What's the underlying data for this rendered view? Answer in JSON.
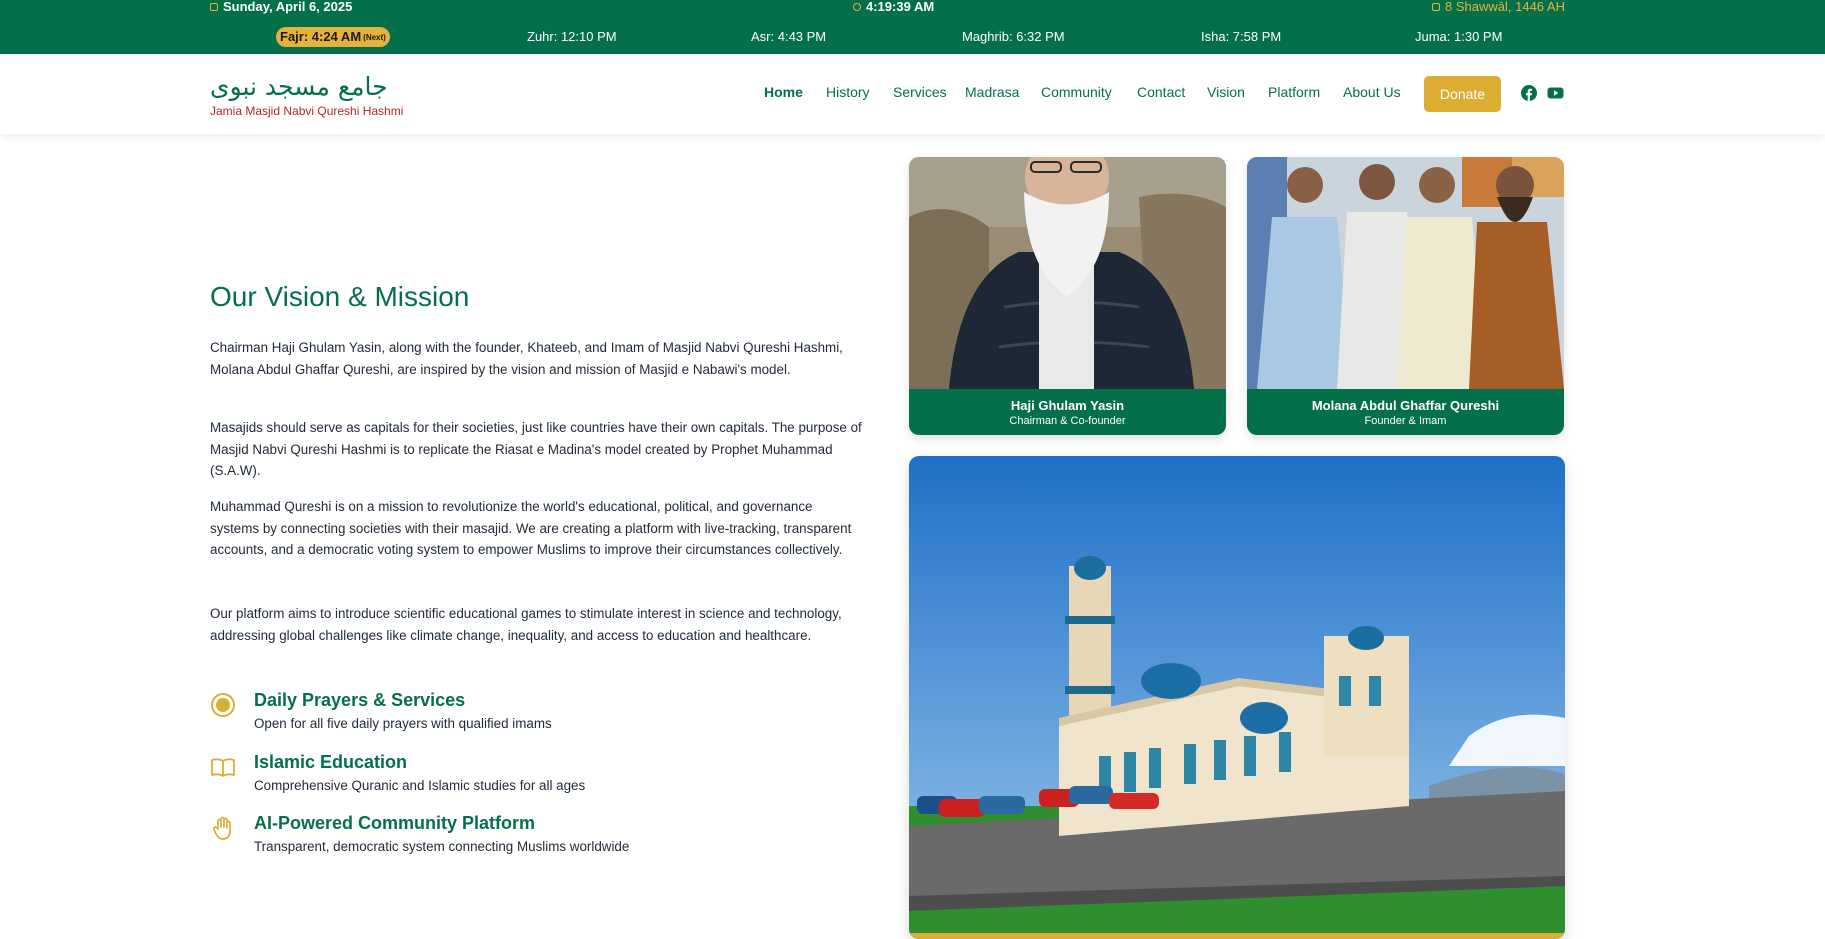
{
  "prayer_bar": {
    "date": "Sunday, April 6, 2025",
    "clock": "4:19:39 AM",
    "hijri": "8 Shawwāl, 1446 AH",
    "prayers": [
      {
        "label": "Fajr: 4:24 AM",
        "next_tag": "(Next)",
        "is_next": true
      },
      {
        "label": "Zuhr: 12:10 PM"
      },
      {
        "label": "Asr: 4:43 PM"
      },
      {
        "label": "Maghrib: 6:32 PM"
      },
      {
        "label": "Isha: 7:58 PM"
      },
      {
        "label": "Juma: 1:30 PM"
      }
    ]
  },
  "header": {
    "logo_arabic": "جامع مسجد نبوی",
    "logo_english": "Jamia Masjid Nabvi Qureshi Hashmi",
    "nav": [
      "Home",
      "History",
      "Services",
      "Madrasa",
      "Community",
      "Contact",
      "Vision",
      "Platform",
      "About Us"
    ],
    "active_nav": "Home",
    "donate_label": "Donate",
    "social": [
      "facebook-icon",
      "youtube-icon"
    ]
  },
  "main": {
    "heading": "Our Vision & Mission",
    "paragraphs": [
      "Chairman Haji Ghulam Yasin, along with the founder, Khateeb, and Imam of Masjid Nabvi Qureshi Hashmi, Molana Abdul Ghaffar Qureshi, are inspired by the vision and mission of Masjid e Nabawi's model.",
      "Masajids should serve as capitals for their societies, just like countries have their own capitals. The purpose of Masjid Nabvi Qureshi Hashmi is to replicate the Riasat e Madina's model created by Prophet Muhammad (S.A.W).",
      "Muhammad Qureshi is on a mission to revolutionize the world's educational, political, and governance systems by connecting societies with their masajid. We are creating a platform with live-tracking, transparent accounts, and a democratic voting system to empower Muslims to improve their circumstances collectively.",
      "Our platform aims to introduce scientific educational games to stimulate interest in science and technology, addressing global challenges like climate change, inequality, and access to education and healthcare."
    ],
    "features": [
      {
        "icon": "target-icon",
        "title": "Daily Prayers & Services",
        "desc": "Open for all five daily prayers with qualified imams"
      },
      {
        "icon": "book-open-icon",
        "title": "Islamic Education",
        "desc": "Comprehensive Quranic and Islamic studies for all ages"
      },
      {
        "icon": "hand-icon",
        "title": "AI-Powered Community Platform",
        "desc": "Transparent, democratic system connecting Muslims worldwide"
      }
    ]
  },
  "people": [
    {
      "name": "Haji Ghulam Yasin",
      "role": "Chairman & Co-founder"
    },
    {
      "name": "Molana Abdul Ghaffar Qureshi",
      "role": "Founder & Imam"
    }
  ],
  "colors": {
    "primary_green": "#04704a",
    "gold": "#dcad33",
    "brand_red": "#b3262b"
  }
}
